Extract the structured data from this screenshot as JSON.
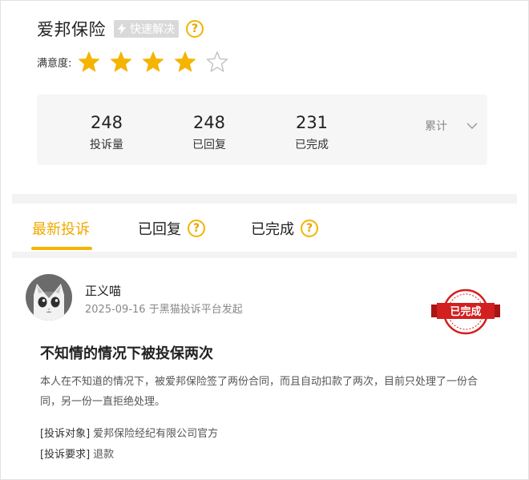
{
  "header": {
    "company": "爱邦保险",
    "fast_badge": "快速解决"
  },
  "rating": {
    "label": "满意度:",
    "value": 4,
    "max": 5
  },
  "stats": {
    "items": [
      {
        "num": "248",
        "label": "投诉量"
      },
      {
        "num": "248",
        "label": "已回复"
      },
      {
        "num": "231",
        "label": "已完成"
      }
    ],
    "period": "累计"
  },
  "tabs": [
    {
      "label": "最新投诉",
      "active": true
    },
    {
      "label": "已回复",
      "active": false
    },
    {
      "label": "已完成",
      "active": false
    }
  ],
  "complaint": {
    "user": "正义喵",
    "date": "2025-09-16",
    "source": "于黑猫投诉平台发起",
    "status": "已完成",
    "title": "不知情的情况下被投保两次",
    "body": "本人在不知道的情况下，被爱邦保险签了两份合同，而且自动扣款了两次，目前只处理了一份合同，另一份一直拒绝处理。",
    "target_label": "[投诉对象]",
    "target_value": "爱邦保险经纪有限公司官方",
    "request_label": "[投诉要求]",
    "request_value": "退款"
  },
  "colors": {
    "accent": "#f4b400",
    "stamp": "#d21f1f",
    "muted": "#888888"
  },
  "icons": {
    "help": "?"
  }
}
